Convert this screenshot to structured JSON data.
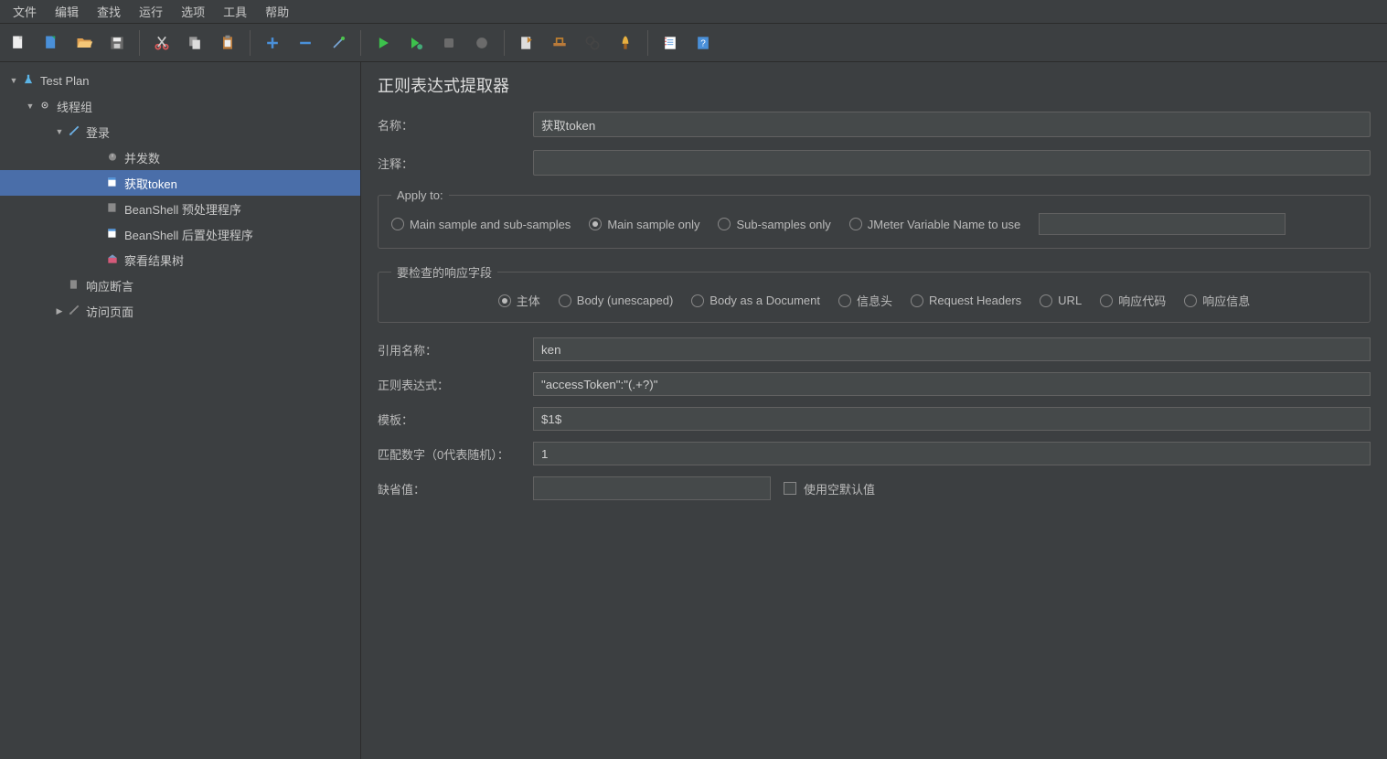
{
  "menu": [
    "文件",
    "编辑",
    "查找",
    "运行",
    "选项",
    "工具",
    "帮助"
  ],
  "tree": {
    "testplan": "Test Plan",
    "threadgroup": "线程组",
    "login": "登录",
    "concurrent": "并发数",
    "gettoken": "获取token",
    "beanshell_pre": "BeanShell 预处理程序",
    "beanshell_post": "BeanShell 后置处理程序",
    "view_results": "察看结果树",
    "response_assert": "响应断言",
    "visit_page": "访问页面"
  },
  "panel": {
    "title": "正则表达式提取器",
    "labels": {
      "name": "名称：",
      "comment": "注释：",
      "apply_to": "Apply to:",
      "response_field": "要检查的响应字段",
      "ref_name": "引用名称：",
      "regex": "正则表达式：",
      "template": "模板：",
      "match_no": "匹配数字（0代表随机）：",
      "default_val": "缺省值：",
      "use_empty": "使用空默认值"
    },
    "values": {
      "name": "获取token",
      "comment": "",
      "ref_name": "ken",
      "regex": "\"accessToken\":\"(.+?)\"",
      "template": "$1$",
      "match_no": "1",
      "default_val": "",
      "jmeter_var": ""
    },
    "apply_options": {
      "o1": "Main sample and sub-samples",
      "o2": "Main sample only",
      "o3": "Sub-samples only",
      "o4": "JMeter Variable Name to use"
    },
    "field_options": {
      "f1": "主体",
      "f2": "Body (unescaped)",
      "f3": "Body as a Document",
      "f4": "信息头",
      "f5": "Request Headers",
      "f6": "URL",
      "f7": "响应代码",
      "f8": "响应信息"
    }
  }
}
